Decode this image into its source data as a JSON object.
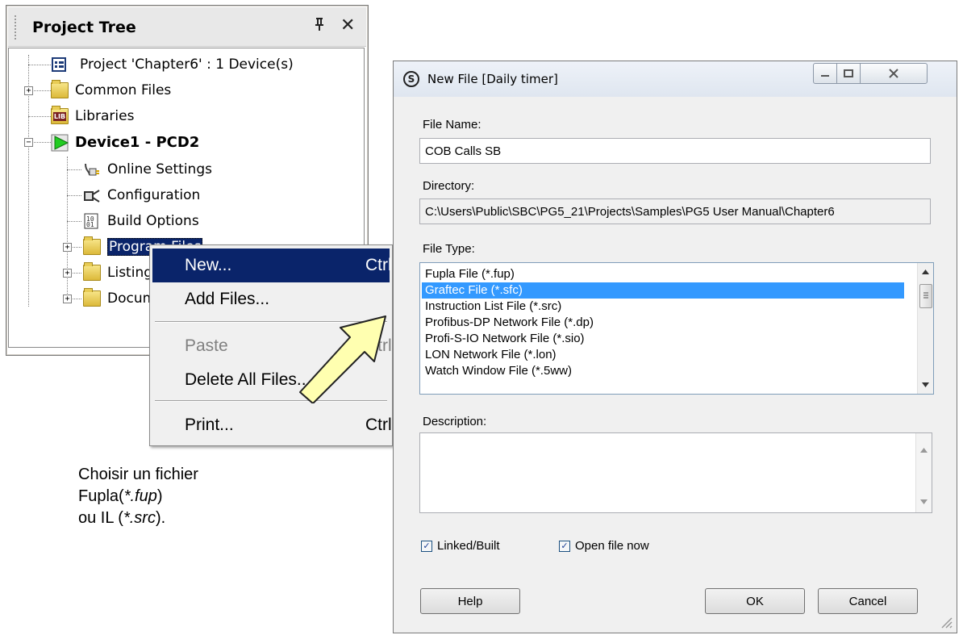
{
  "project_tree": {
    "title": "Project Tree",
    "pin_glyph": "¤",
    "close_glyph": "✕",
    "nodes": [
      {
        "label": "Project 'Chapter6' : 1 Device(s)",
        "icon": "project-icon"
      },
      {
        "label": "Common Files",
        "icon": "folder-icon"
      },
      {
        "label": "Libraries",
        "icon": "library-icon"
      },
      {
        "label": "Device1 - PCD2",
        "icon": "device-icon"
      },
      {
        "label": "Online Settings",
        "icon": "online-settings-icon"
      },
      {
        "label": "Configuration",
        "icon": "configuration-icon"
      },
      {
        "label": "Build Options",
        "icon": "build-options-icon"
      },
      {
        "label": "Program Files",
        "icon": "folder-icon"
      },
      {
        "label": "Listing Files",
        "icon": "folder-icon"
      },
      {
        "label": "Documentation",
        "icon": "folder-icon"
      }
    ],
    "lib_badge": "LIB"
  },
  "context_menu": {
    "items": [
      {
        "label": "New...",
        "shortcut": "Ctrl"
      },
      {
        "label": "Add Files...",
        "shortcut": ""
      },
      {
        "label": "Paste",
        "shortcut": "Ctrl"
      },
      {
        "label": "Delete All Files...",
        "shortcut": ""
      },
      {
        "label": "Print...",
        "shortcut": "Ctrl"
      }
    ]
  },
  "caption": {
    "line1": "Choisir un fichier",
    "line2_a": "Fupla(",
    "line2_b": "*.fup",
    "line2_c": ")",
    "line3_a": "ou IL (",
    "line3_b": "*.src",
    "line3_c": ")."
  },
  "dialog": {
    "title": "New File [Daily timer]",
    "app_icon_glyph": "S",
    "file_name_label": "File Name:",
    "file_name_value": "COB Calls SB",
    "directory_label": "Directory:",
    "directory_value": "C:\\Users\\Public\\SBC\\PG5_21\\Projects\\Samples\\PG5 User Manual\\Chapter6",
    "file_type_label": "File Type:",
    "file_types": [
      "Fupla File (*.fup)",
      "Graftec File (*.sfc)",
      "Instruction List File (*.src)",
      "Profibus-DP Network File (*.dp)",
      "Profi-S-IO Network File (*.sio)",
      "LON Network File (*.lon)",
      "Watch Window File (*.5ww)"
    ],
    "selected_file_type": "Graftec File (*.sfc)",
    "description_label": "Description:",
    "description_value": "",
    "linked_built_label": "Linked/Built",
    "linked_built_checked": true,
    "open_file_now_label": "Open file now",
    "open_file_now_checked": true,
    "help_label": "Help",
    "ok_label": "OK",
    "cancel_label": "Cancel"
  },
  "colors": {
    "menu_highlight": "#0a246a",
    "list_selection": "#3399ff",
    "arrow_fill": "#ffffb0",
    "device_icon": "#22cc22"
  }
}
